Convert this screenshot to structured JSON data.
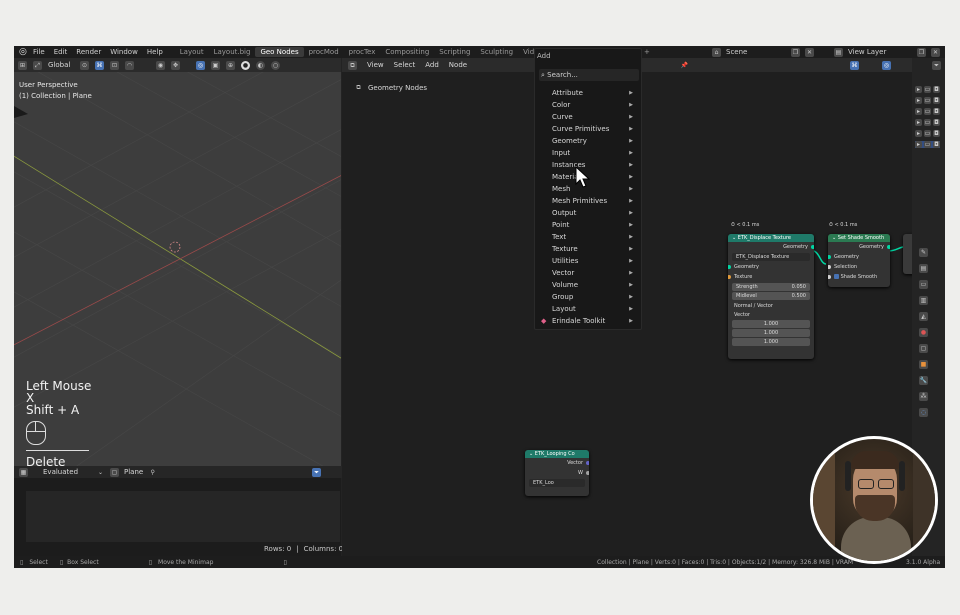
{
  "colors": {
    "accent": "#4772b3",
    "geo_socket": "#00d6a3",
    "vector_socket": "#6363c7",
    "float_socket": "#a1a1a1",
    "texture_socket": "#e09a3b",
    "node_teal": "#1f7a69",
    "node_green": "#2b7a52",
    "outer_bg": "#eeeeec"
  },
  "topbar": {
    "menus": [
      "File",
      "Edit",
      "Render",
      "Window",
      "Help"
    ],
    "workspaces": [
      "Layout",
      "Layout.big",
      "Geo Nodes",
      "procMod",
      "procTex",
      "Compositing",
      "Scripting",
      "Sculpting",
      "Video Edi"
    ],
    "scene": "Scene",
    "view_layer": "View Layer"
  },
  "viewport": {
    "orientation": "Global",
    "perspective": "User Perspective",
    "collection": "(1) Collection | Plane",
    "keys": [
      "Left Mouse",
      "X",
      "Shift + A"
    ],
    "last_key": "Delete"
  },
  "spreadsheet": {
    "mode": "Evaluated",
    "object": "Plane",
    "rows": "Rows: 0",
    "sep": "|",
    "cols": "Columns: 0"
  },
  "node_editor": {
    "menus": [
      "View",
      "Select",
      "Add",
      "Node"
    ],
    "breadcrumb": "Geometry Nodes"
  },
  "add_menu": {
    "title": "Add",
    "search": "Search...",
    "items": [
      "Attribute",
      "Color",
      "Curve",
      "Curve Primitives",
      "Geometry",
      "Input",
      "Instances",
      "Material",
      "Mesh",
      "Mesh Primitives",
      "Output",
      "Point",
      "Text",
      "Texture",
      "Utilities",
      "Vector",
      "Volume",
      "Group",
      "Layout",
      "Erindale Toolkit"
    ]
  },
  "nodes": {
    "displace": {
      "timer": "< 0.1 ms",
      "title": "ETK_Displace Texture",
      "tree": "ETK_Displace Texture",
      "out": "Geometry",
      "in_geo": "Geometry",
      "texture": "Texture",
      "strength_label": "Strength",
      "strength": "0.050",
      "midlevel_label": "Midlevel",
      "midlevel": "0.500",
      "normal": "Normal / Vector",
      "vector_label": "Vector",
      "vx": "1.000",
      "vy": "1.000",
      "vz": "1.000"
    },
    "smooth": {
      "timer": "< 0.1 ms",
      "title": "Set Shade Smooth",
      "out": "Geometry",
      "geo": "Geometry",
      "selection": "Selection",
      "shade": "Shade Smooth"
    },
    "loop": {
      "title": "ETK_Looping Co",
      "vector": "Vector",
      "w": "W",
      "tree": "ETK_Loo"
    }
  },
  "statusbar": {
    "left": [
      "Select",
      "Box Select",
      "Move the Minimap"
    ],
    "right": "Collection | Plane | Verts:0 | Faces:0 | Tris:0 | Objects:1/2 | Memory: 326.8 MiB | VRAM",
    "version": "3.1.0 Alpha"
  }
}
